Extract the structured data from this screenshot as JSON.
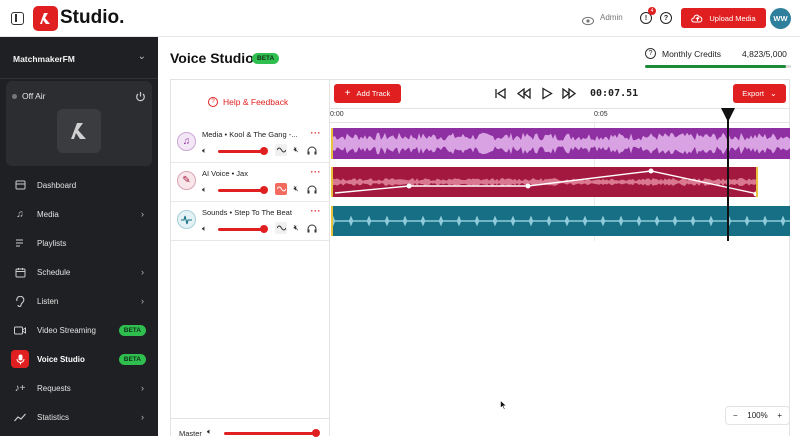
{
  "topbar": {
    "brand": "Studio.",
    "user_role": "Admin",
    "notif_count": "4",
    "upload_label": "Upload Media",
    "avatar_initials": "WW"
  },
  "sidebar": {
    "station": "MatchmakerFM",
    "status": "Off Air",
    "items": [
      {
        "label": "Dashboard",
        "icon": "dashboard-icon"
      },
      {
        "label": "Media",
        "icon": "music-icon"
      },
      {
        "label": "Playlists",
        "icon": "playlist-icon"
      },
      {
        "label": "Schedule",
        "icon": "calendar-icon"
      },
      {
        "label": "Listen",
        "icon": "listen-icon"
      },
      {
        "label": "Video Streaming",
        "icon": "video-icon",
        "badge": "BETA"
      },
      {
        "label": "Voice Studio",
        "icon": "mic-icon",
        "badge": "BETA"
      },
      {
        "label": "Requests",
        "icon": "requests-icon"
      },
      {
        "label": "Statistics",
        "icon": "statistics-icon"
      }
    ]
  },
  "page": {
    "title": "Voice Studio",
    "title_badge": "BETA",
    "credits_label": "Monthly Credits",
    "credits_value": "4,823/5,000",
    "credits_fraction": 0.9646
  },
  "editor": {
    "help_label": "Help & Feedback",
    "add_track_label": "Add Track",
    "timecode": "00:07.51",
    "export_label": "Export",
    "ruler": [
      "0:00",
      "0:05"
    ],
    "tracks": [
      {
        "name": "Media • Kool & The Gang -...",
        "color": "#8e2fa2"
      },
      {
        "name": "AI Voice • Jax",
        "color": "#a3183e"
      },
      {
        "name": "Sounds • Step To The Beat",
        "color": "#166f85"
      }
    ],
    "master_label": "Master",
    "zoom": "100%",
    "zoom_minus": "−",
    "zoom_plus": "+"
  },
  "colors": {
    "accent": "#e02020",
    "badge": "#2fbf4f",
    "sidebar_bg": "#1f2023"
  }
}
